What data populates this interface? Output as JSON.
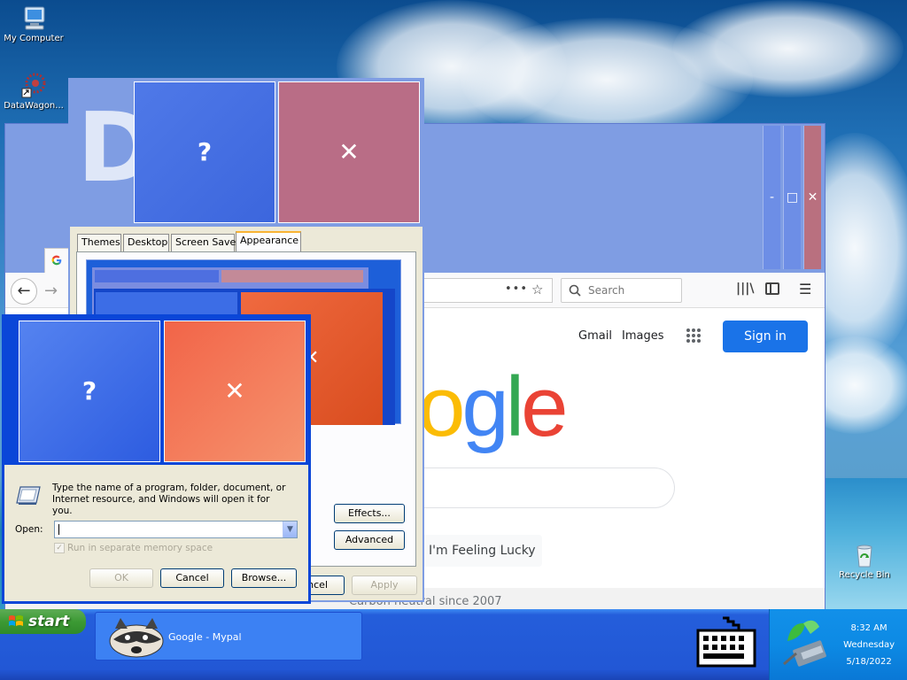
{
  "desktop": {
    "icons": [
      {
        "label": "My Computer"
      },
      {
        "label": "DataWagon..."
      },
      {
        "label": "Recycle Bin"
      }
    ]
  },
  "firefox": {
    "search_placeholder": "Search",
    "google": {
      "gmail": "Gmail",
      "images": "Images",
      "signin": "Sign in",
      "logo_partial": "ogle",
      "lucky": "I'm Feeling Lucky",
      "footer": "Carbon neutral since 2007"
    },
    "controls": {
      "min": "-",
      "max": "□",
      "close": "✕"
    }
  },
  "display_props": {
    "tabs": [
      "Themes",
      "Desktop",
      "Screen Saver",
      "Appearance"
    ],
    "effects": "Effects...",
    "advanced": "Advanced",
    "cancel_partial": "ncel",
    "apply": "Apply",
    "help_glyph": "?",
    "close_glyph": "✕",
    "title_letter": "D"
  },
  "run": {
    "description": "Type the name of a program, folder, document, or Internet resource, and Windows will open it for you.",
    "open_label": "Open:",
    "open_value": "",
    "memory_label": "Run in separate memory space",
    "ok": "OK",
    "cancel": "Cancel",
    "browse": "Browse...",
    "help_glyph": "?",
    "close_glyph": "✕"
  },
  "taskbar": {
    "start": "start",
    "task_label": "Google - Mypal",
    "time": "8:32 AM",
    "day": "Wednesday",
    "date": "5/18/2022"
  },
  "colors": {
    "google_blue": "#4285f4",
    "google_red": "#ea4335",
    "google_yellow": "#fbbc05",
    "google_green": "#34a853",
    "signin_blue": "#1a73e8"
  }
}
